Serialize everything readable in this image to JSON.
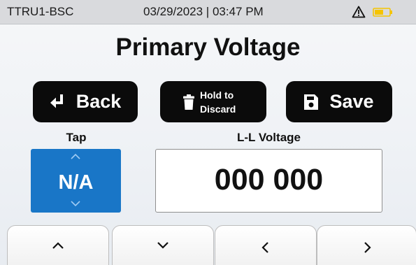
{
  "status": {
    "device_id": "TTRU1-BSC",
    "datetime": "03/29/2023 | 03:47 PM",
    "icons": [
      "warning-icon",
      "battery-icon"
    ],
    "battery_color": "#f5c400"
  },
  "page": {
    "title": "Primary Voltage"
  },
  "actions": {
    "back_label": "Back",
    "discard_label": "Hold to Discard",
    "save_label": "Save",
    "icons": [
      "enter-arrow-icon",
      "trash-icon",
      "floppy-disk-icon"
    ]
  },
  "tap": {
    "label": "Tap",
    "value": "N/A",
    "accent_color": "#1976c7"
  },
  "voltage": {
    "label": "L-L Voltage",
    "value": "000 000"
  },
  "nav_keys": [
    "chevron-up-icon",
    "chevron-down-icon",
    "chevron-left-icon",
    "chevron-right-icon"
  ]
}
